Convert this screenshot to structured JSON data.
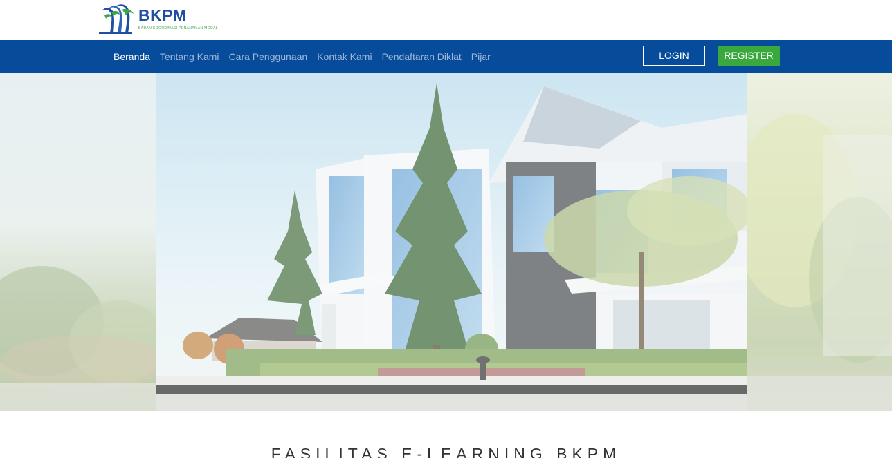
{
  "brand": {
    "name": "BKPM",
    "tagline": "BADAN KOORDINASI PENANAMAN MODAL",
    "primary_color": "#1f4fa3",
    "accent_color": "#3aa648"
  },
  "nav": {
    "background": "#074b9b",
    "links": [
      {
        "label": "Beranda",
        "active": true
      },
      {
        "label": "Tentang Kami",
        "active": false
      },
      {
        "label": "Cara Penggunaan",
        "active": false
      },
      {
        "label": "Kontak Kami",
        "active": false
      },
      {
        "label": "Pendaftaran Diklat",
        "active": false
      },
      {
        "label": "Pijar",
        "active": false
      }
    ],
    "login_label": "LOGIN",
    "register_label": "REGISTER",
    "register_color": "#39a93d"
  },
  "hero": {
    "image": "building-photo"
  },
  "section": {
    "title": "FASILITAS E-LEARNING BKPM"
  }
}
